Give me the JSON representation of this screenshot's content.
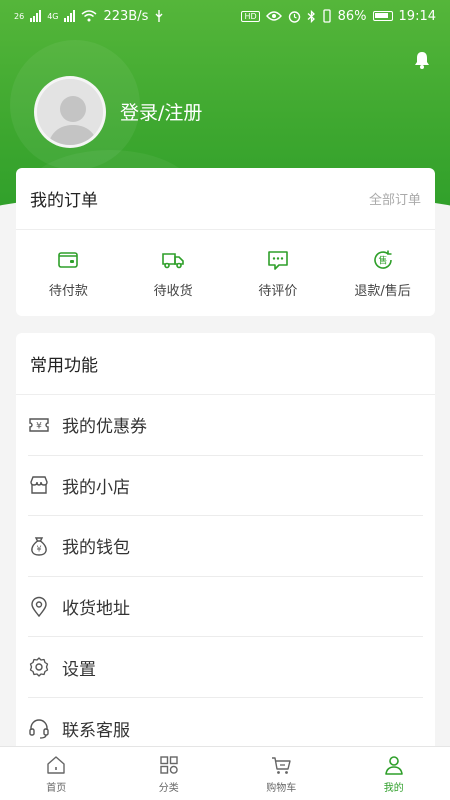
{
  "status_bar": {
    "speed": "223B/s",
    "net1": "26",
    "net2": "4G",
    "battery_pct": "86%",
    "time": "19:14"
  },
  "profile": {
    "login_label": "登录/注册"
  },
  "orders": {
    "title": "我的订单",
    "all_label": "全部订单",
    "items": [
      {
        "label": "待付款",
        "icon": "wallet-icon"
      },
      {
        "label": "待收货",
        "icon": "truck-icon"
      },
      {
        "label": "待评价",
        "icon": "comment-icon"
      },
      {
        "label": "退款/售后",
        "icon": "after-sale-icon"
      }
    ]
  },
  "functions": {
    "title": "常用功能",
    "items": [
      {
        "label": "我的优惠券",
        "icon": "coupon-icon"
      },
      {
        "label": "我的小店",
        "icon": "shop-icon"
      },
      {
        "label": "我的钱包",
        "icon": "money-bag-icon"
      },
      {
        "label": "收货地址",
        "icon": "location-icon"
      },
      {
        "label": "设置",
        "icon": "gear-icon"
      },
      {
        "label": "联系客服",
        "icon": "headset-icon"
      }
    ]
  },
  "tabbar": {
    "items": [
      {
        "label": "首页",
        "icon": "home-icon"
      },
      {
        "label": "分类",
        "icon": "category-icon"
      },
      {
        "label": "购物车",
        "icon": "cart-icon"
      },
      {
        "label": "我的",
        "icon": "user-icon",
        "active": true
      }
    ]
  },
  "colors": {
    "brand": "#3da72f",
    "active_tab": "#2f9f2a",
    "icon_green": "#2f9f2a",
    "icon_gray": "#666666"
  }
}
